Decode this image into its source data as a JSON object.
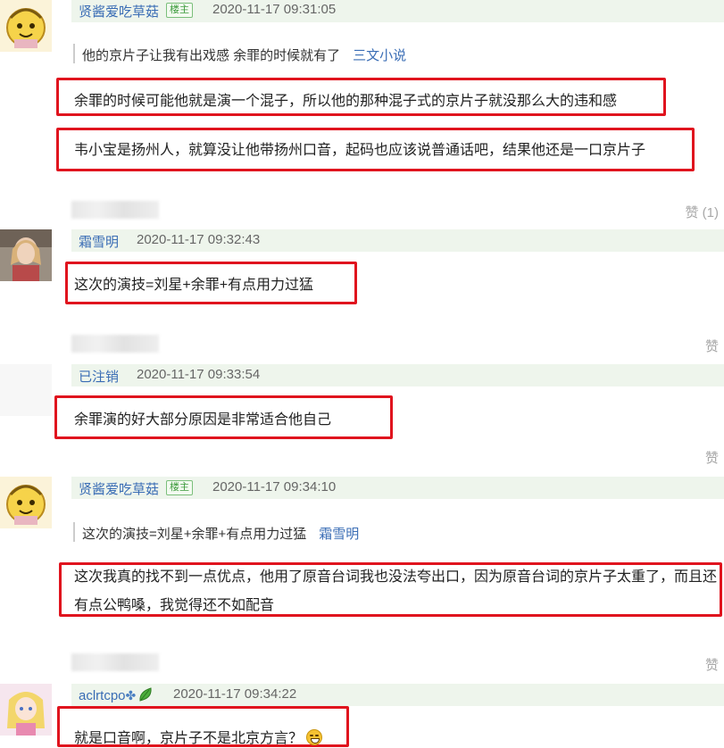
{
  "comments": [
    {
      "user": "贤酱爱吃草菇",
      "badge": "楼主",
      "time": "2020-11-17 09:31:05",
      "quote_text": "他的京片子让我有出戏感 余罪的时候就有了",
      "quote_author": "三文小说",
      "paragraphs": [
        "余罪的时候可能他就是演一个混子，所以他的那种混子式的京片子就没那么大的违和感",
        "韦小宝是扬州人，就算没让他带扬州口音，起码也应该说普通话吧，结果他还是一口京片子"
      ],
      "like": "赞 (1)"
    },
    {
      "user": "霜雪明",
      "time": "2020-11-17 09:32:43",
      "paragraphs": [
        "这次的演技=刘星+余罪+有点用力过猛"
      ],
      "like": "赞"
    },
    {
      "user": "已注销",
      "time": "2020-11-17 09:33:54",
      "paragraphs": [
        "余罪演的好大部分原因是非常适合他自己"
      ],
      "like": "赞"
    },
    {
      "user": "贤酱爱吃草菇",
      "badge": "楼主",
      "time": "2020-11-17 09:34:10",
      "quote_text": "这次的演技=刘星+余罪+有点用力过猛",
      "quote_author": "霜雪明",
      "paragraphs": [
        "这次我真的找不到一点优点，他用了原音台词我也没法夸出口，因为原音台词的京片子太重了，而且还有点公鸭嗓，我觉得还不如配音"
      ],
      "like": "赞"
    },
    {
      "user": "aclrtcpo",
      "user_suffix": "✤",
      "time": "2020-11-17 09:34:22",
      "paragraphs": [
        "就是口音啊，京片子不是北京方言？"
      ]
    }
  ],
  "icons": {
    "avatar_1": "yellow-cartoon-avatar",
    "avatar_2": "girl-photo-avatar",
    "avatar_5": "anime-girl-avatar",
    "leaf": "green-leaf-icon",
    "emoji": "grinning-emoji-icon"
  },
  "colors": {
    "username": "#3a6db5",
    "highlight_box": "#e0141e",
    "header_bg": "#eef5ec",
    "badge": "#3c9a3c"
  }
}
